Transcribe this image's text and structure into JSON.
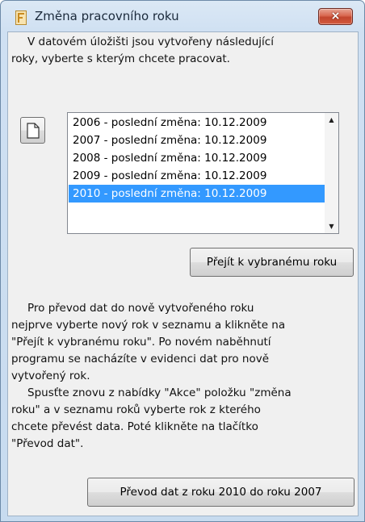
{
  "window": {
    "title": "Změna pracovního roku",
    "close_label": "×"
  },
  "intro": {
    "line1": "V datovém úložišti jsou vytvořeny následující",
    "line2": "roky, vyberte s kterým chcete pracovat."
  },
  "new_button": {
    "icon": "new-document-icon"
  },
  "years_list": {
    "items": [
      "2006 - poslední změna: 10.12.2009",
      "2007 - poslední změna: 10.12.2009",
      "2008 - poslední změna: 10.12.2009",
      "2009 - poslední změna: 10.12.2009",
      "2010 - poslední změna: 10.12.2009"
    ],
    "selected_index": 4,
    "scroll_up": "▲",
    "scroll_down": "▼"
  },
  "buttons": {
    "go_to_year": "Přejít k vybranému roku",
    "transfer": "Převod dat z roku 2010 do roku 2007"
  },
  "help": {
    "p1": [
      "Pro převod dat do nově vytvořeného roku",
      "nejprve vyberte nový rok v seznamu a klikněte na",
      "\"Přejít k vybranému roku\". Po novém naběhnutí",
      "programu se nacházíte v evidenci dat pro nově",
      "vytvořený  rok."
    ],
    "p2": [
      "Spusťte znovu z nabídky \"Akce\" položku \"změna",
      "roku\" a v seznamu roků vyberte rok z kterého",
      "chcete převést data. Poté klikněte na tlačítko",
      "\"Převod dat\"."
    ]
  },
  "colors": {
    "selection": "#3399ff",
    "close_button": "#c9503a",
    "title_bar": "#cfe0f2"
  }
}
